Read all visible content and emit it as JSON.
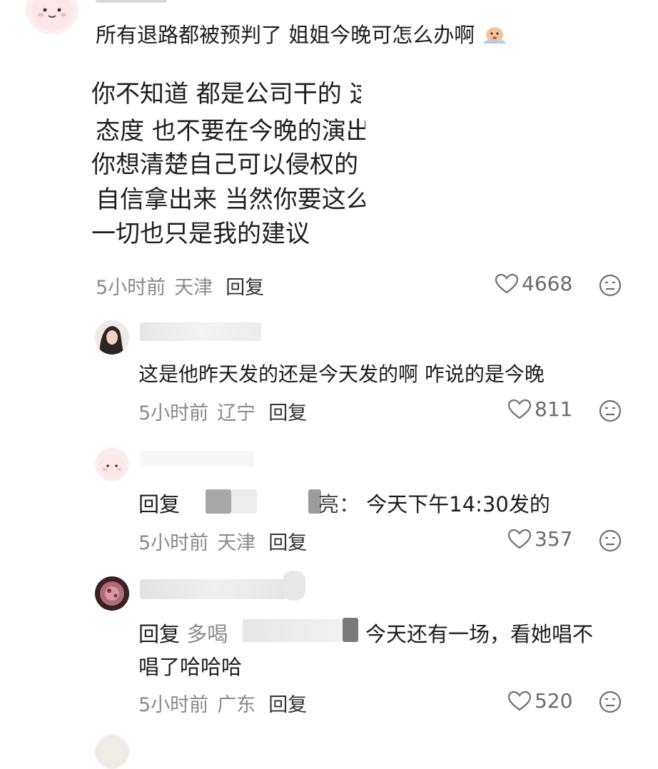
{
  "top_comment": {
    "text": "所有退路都被预判了 姐姐今晚可怎么办啊",
    "emoji": "face-in-clouds-emoji",
    "quote_lines": [
      "你不知道 都是公司干的 这",
      "态度 也不要在今晚的演出",
      "你想清楚自己可以侵权的",
      "自信拿出来 当然你要这么",
      "一切也只是我的建议"
    ],
    "time": "5小时前",
    "location": "天津",
    "reply_label": "回复",
    "likes": "4668"
  },
  "replies": [
    {
      "text": "这是他昨天发的还是今天发的啊 咋说的是今晚",
      "time": "5小时前",
      "location": "辽宁",
      "reply_label": "回复",
      "likes": "811"
    },
    {
      "reply_prefix": "回复",
      "target_tail": "亮",
      "colon": "：",
      "text": "今天下午14:30发的",
      "time": "5小时前",
      "location": "天津",
      "reply_label": "回复",
      "likes": "357"
    },
    {
      "reply_prefix": "回复",
      "target_partial": "多喝",
      "text_line1": "今天还有一场，看她唱不",
      "text_line2": "唱了哈哈哈",
      "time": "5小时前",
      "location": "广东",
      "reply_label": "回复",
      "likes": "520"
    }
  ],
  "colors": {
    "meta_gray": "#8a8a8a",
    "text": "#1c1c1c",
    "like_gray": "#6a6a6a"
  }
}
